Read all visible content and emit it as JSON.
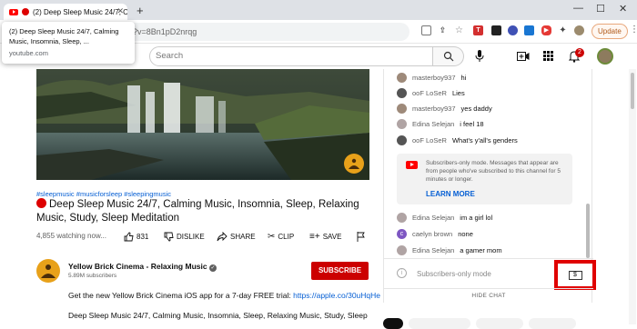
{
  "browser": {
    "tab_title": "(2) Deep Sleep Music 24/7, C",
    "url_fragment": "?v=8Bn1pD2nrqg",
    "update_label": "Update"
  },
  "tooltip": {
    "title": "(2) Deep Sleep Music 24/7, Calming Music, Insomnia, Sleep, ...",
    "url": "youtube.com"
  },
  "header": {
    "search_placeholder": "Search",
    "notification_count": "2"
  },
  "video": {
    "hashtags": "#sleepmusic #musicforsleep #sleepingmusic",
    "title": "Deep Sleep Music 24/7, Calming Music, Insomnia, Sleep, Relaxing Music, Study, Sleep Meditation",
    "watching": "4,855 watching now...",
    "like_count": "831",
    "dislike_label": "DISLIKE",
    "share_label": "SHARE",
    "clip_label": "CLIP",
    "save_label": "SAVE"
  },
  "channel": {
    "name": "Yellow Brick Cinema - Relaxing Music",
    "subscribers": "5.89M subscribers",
    "subscribe_label": "SUBSCRIBE",
    "desc_line1": "Get the new Yellow Brick Cinema iOS app for a 7-day FREE trial: ",
    "desc_link": "https://apple.co/30uHqHe",
    "desc_line2": "Deep Sleep Music 24/7, Calming Music, Insomnia, Sleep, Relaxing Music, Study, Sleep"
  },
  "chat": {
    "messages": [
      {
        "author": "masterboy937",
        "text": "hi",
        "color": "#9e8a7a"
      },
      {
        "author": "ooF LoSeR",
        "text": "Lies",
        "color": "#555555"
      },
      {
        "author": "masterboy937",
        "text": "yes daddy",
        "color": "#9e8a7a"
      },
      {
        "author": "Edina Selejan",
        "text": "i feel 18",
        "color": "#b0a4a4"
      },
      {
        "author": "ooF LoSeR",
        "text": "What's y'all's genders",
        "color": "#555555"
      },
      {
        "author": "Edina Selejan",
        "text": "im a girl lol",
        "color": "#b0a4a4"
      },
      {
        "author": "caelyn brown",
        "text": "none",
        "color": "#7e57c2"
      },
      {
        "author": "Edina Selejan",
        "text": "a gamer mom",
        "color": "#b0a4a4"
      }
    ],
    "notice_text": "Subscribers-only mode. Messages that appear are from people who've subscribed to this channel for 5 minutes or longer.",
    "learn_more": "LEARN MORE",
    "input_placeholder": "Subscribers-only mode",
    "hide_chat": "HIDE CHAT",
    "avatar_initial": "c"
  }
}
